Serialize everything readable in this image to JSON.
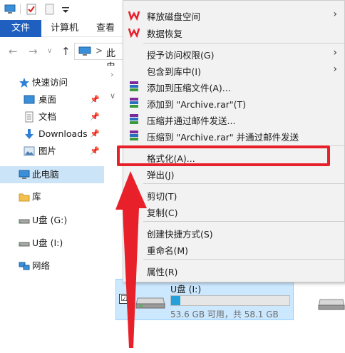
{
  "ribbon": {
    "file_tab": "文件",
    "tabs": [
      "计算机",
      "查看"
    ]
  },
  "address": {
    "separator": ">",
    "path_text": "此电"
  },
  "sidebar": {
    "items": [
      {
        "label": "快速访问",
        "icon": "star-icon"
      },
      {
        "label": "桌面",
        "icon": "desktop-icon",
        "pinned": true
      },
      {
        "label": "文档",
        "icon": "document-icon",
        "pinned": true
      },
      {
        "label": "Downloads",
        "icon": "download-icon",
        "pinned": true
      },
      {
        "label": "图片",
        "icon": "picture-icon",
        "pinned": true
      },
      {
        "label": "此电脑",
        "icon": "computer-icon",
        "selected": true
      },
      {
        "label": "库",
        "icon": "library-icon"
      },
      {
        "label": "U盘 (G:)",
        "icon": "usb-drive-icon"
      },
      {
        "label": "U盘 (I:)",
        "icon": "usb-drive-icon"
      },
      {
        "label": "网络",
        "icon": "network-icon"
      }
    ]
  },
  "drive": {
    "name": "U盘 (I:)",
    "space_text": "53.6 GB 可用，共 58.1 GB",
    "used_fraction": 0.08,
    "checkbox": "☑"
  },
  "menu": {
    "items": [
      {
        "label": "释放磁盘空间",
        "icon": "wps-icon",
        "submenu": true
      },
      {
        "label": "数据恢复",
        "icon": "wps-icon"
      },
      {
        "label": "授予访问权限(G)",
        "submenu": true
      },
      {
        "label": "包含到库中(I)",
        "submenu": true
      },
      {
        "label": "添加到压缩文件(A)...",
        "icon": "winrar-icon"
      },
      {
        "label": "添加到 \"Archive.rar\"(T)",
        "icon": "winrar-icon"
      },
      {
        "label": "压缩并通过邮件发送...",
        "icon": "winrar-icon"
      },
      {
        "label": "压缩到 \"Archive.rar\" 并通过邮件发送",
        "icon": "winrar-icon"
      },
      {
        "label": "格式化(A)..."
      },
      {
        "label": "弹出(J)"
      },
      {
        "label": "剪切(T)"
      },
      {
        "label": "复制(C)"
      },
      {
        "label": "创建快捷方式(S)"
      },
      {
        "label": "重命名(M)"
      },
      {
        "label": "属性(R)"
      }
    ],
    "submenu_glyph": "›"
  },
  "colors": {
    "accent": "#1f5fbf",
    "highlight": "#e8202a",
    "selection": "#cce8ff"
  }
}
